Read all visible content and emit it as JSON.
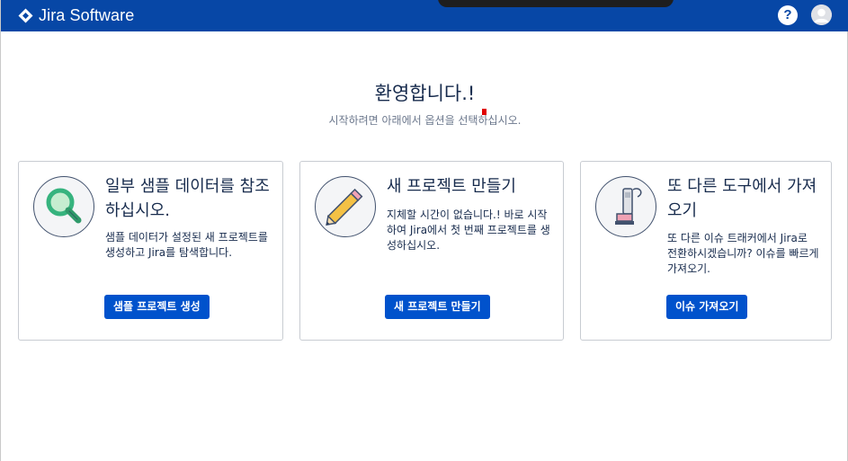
{
  "header": {
    "product_name": "Jira Software",
    "help_label": "?",
    "brand_color": "#0747a6"
  },
  "welcome": {
    "title": "환영합니다.!",
    "subtitle": "시작하려면 아래에서 옵션을 선택하십시오."
  },
  "cards": [
    {
      "icon": "magnifying-glass-icon",
      "title": "일부 샘플 데이터를 참조하십시오.",
      "description": "샘플 데이터가 설정된 새 프로젝트를 생성하고 Jira를 탐색합니다.",
      "button_label": "샘플 프로젝트 생성"
    },
    {
      "icon": "pencil-icon",
      "title": "새 프로젝트 만들기",
      "description": "지체할 시간이 없습니다.! 바로 시작하여 Jira에서 첫 번째 프로젝트를 생성하십시오.",
      "button_label": "새 프로젝트 만들기"
    },
    {
      "icon": "vacuum-cleaner-icon",
      "title": "또 다른 도구에서 가져오기",
      "description": "또 다른 이슈 트래커에서 Jira로 전환하시겠습니까? 이슈를 빠르게 가져오기.",
      "button_label": "이슈 가져오기"
    }
  ],
  "colors": {
    "primary_button": "#0052cc",
    "text": "#172b4d",
    "muted_text": "#6b778c"
  }
}
